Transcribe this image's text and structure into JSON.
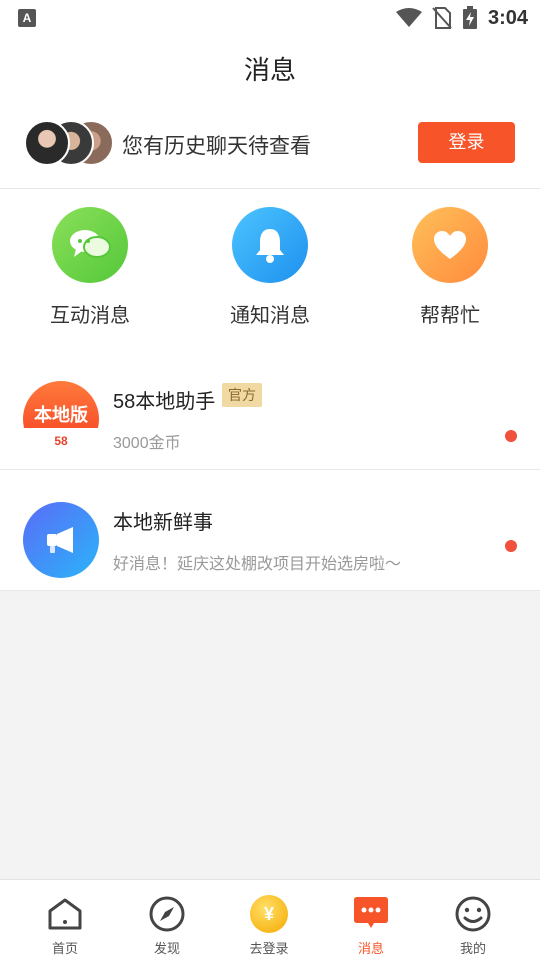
{
  "status_bar": {
    "time": "3:04",
    "left_icon": "A"
  },
  "header": {
    "title": "消息"
  },
  "history": {
    "text": "您有历史聊天待查看",
    "login_label": "登录"
  },
  "categories": [
    {
      "label": "互动消息",
      "icon": "chat-bubbles-icon",
      "color": "#6fd24c"
    },
    {
      "label": "通知消息",
      "icon": "bell-icon",
      "color": "#2aa6f2"
    },
    {
      "label": "帮帮忙",
      "icon": "heart-icon",
      "color": "#ff9a3c"
    }
  ],
  "messages": [
    {
      "title": "58本地助手",
      "tag": "官方",
      "subtitle": "3000金币",
      "badge_text": "本地版",
      "logo_text": "58",
      "unread": true
    },
    {
      "title": "本地新鲜事",
      "subtitle": "好消息！延庆这处棚改项目开始选房啦～",
      "unread": true
    }
  ],
  "bottom_nav": [
    {
      "label": "首页",
      "icon": "home-icon",
      "active": false
    },
    {
      "label": "发现",
      "icon": "compass-icon",
      "active": false
    },
    {
      "label": "去登录",
      "icon": "coin-icon",
      "active": false,
      "coin_symbol": "¥"
    },
    {
      "label": "消息",
      "icon": "message-icon",
      "active": true
    },
    {
      "label": "我的",
      "icon": "smiley-icon",
      "active": false
    }
  ],
  "colors": {
    "accent": "#f7542a",
    "tag_bg": "#f1d9a4",
    "unread_dot": "#f0503c"
  }
}
